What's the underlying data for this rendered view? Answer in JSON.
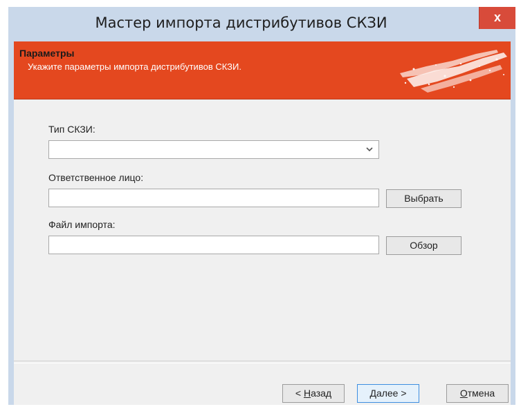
{
  "window": {
    "title": "Мастер импорта дистрибутивов СКЗИ",
    "close_label": "x"
  },
  "banner": {
    "title": "Параметры",
    "subtitle": "Укажите параметры импорта дистрибутивов СКЗИ."
  },
  "form": {
    "skzi_type_label": "Тип СКЗИ:",
    "skzi_type_value": "",
    "responsible_label": "Ответственное лицо:",
    "responsible_value": "",
    "select_button": "Выбрать",
    "import_file_label": "Файл импорта:",
    "import_file_value": "",
    "browse_button": "Обзор"
  },
  "footer": {
    "back": {
      "accel": "Н",
      "rest": "азад",
      "prefix": "< "
    },
    "next": {
      "accel": "Д",
      "rest": "алее >"
    },
    "cancel": {
      "accel": "О",
      "rest": "тмена"
    }
  },
  "colors": {
    "banner": "#e4481f",
    "frame": "#c9d8ea",
    "close": "#d84b3a"
  }
}
